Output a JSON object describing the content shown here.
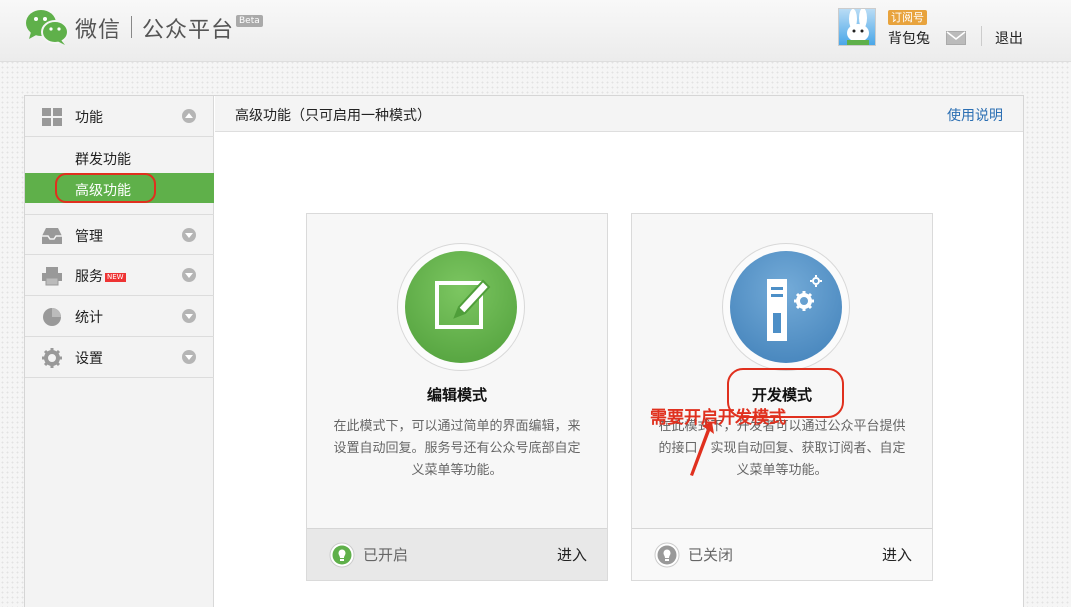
{
  "header": {
    "logo_text": "微信",
    "logo_sub": "公众平台",
    "beta": "Beta",
    "account_type": "订阅号",
    "account_name": "背包兔",
    "logout": "退出"
  },
  "sidebar": {
    "sections": [
      {
        "label": "功能",
        "icon": "grid-icon",
        "expanded": true
      },
      {
        "label": "管理",
        "icon": "inbox-icon"
      },
      {
        "label": "服务",
        "icon": "printer-icon",
        "badge": "NEW"
      },
      {
        "label": "统计",
        "icon": "pie-chart-icon"
      },
      {
        "label": "设置",
        "icon": "gear-icon"
      }
    ],
    "sub_items": [
      {
        "label": "群发功能",
        "active": false
      },
      {
        "label": "高级功能",
        "active": true
      }
    ]
  },
  "content": {
    "title": "高级功能（只可启用一种模式）",
    "help_link": "使用说明",
    "cards": [
      {
        "title": "编辑模式",
        "desc": "在此模式下，可以通过简单的界面编辑，来设置自动回复。服务号还有公众号底部自定义菜单等功能。",
        "status": "已开启",
        "enter": "进入",
        "icon": "edit-icon",
        "accent": "#5fb04a"
      },
      {
        "title": "开发模式",
        "desc": "在此模式下，开发者可以通过公众平台提供的接口，实现自动回复、获取订阅者、自定义菜单等功能。",
        "status": "已关闭",
        "enter": "进入",
        "icon": "server-gear-icon",
        "accent": "#4d8fc7"
      }
    ],
    "annotation_hint": "需要开启开发模式"
  },
  "colors": {
    "active_green": "#5fb04a",
    "link_blue": "#2b6fb3",
    "annotation_red": "#e0301e"
  }
}
